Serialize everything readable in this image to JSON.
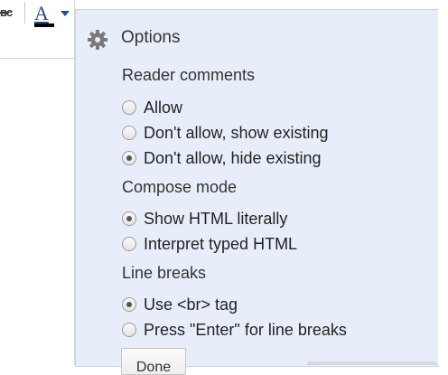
{
  "toolbar": {
    "strikethrough_glyph": "ᴃᴄ",
    "font_color_glyph": "A"
  },
  "options": {
    "title": "Options",
    "icon": "gear-icon",
    "sections": [
      {
        "label": "Reader comments",
        "choices": [
          {
            "label": "Allow",
            "selected": false
          },
          {
            "label": "Don't allow, show existing",
            "selected": false
          },
          {
            "label": "Don't allow, hide existing",
            "selected": true
          }
        ]
      },
      {
        "label": "Compose mode",
        "choices": [
          {
            "label": "Show HTML literally",
            "selected": true
          },
          {
            "label": "Interpret typed HTML",
            "selected": false
          }
        ]
      },
      {
        "label": "Line breaks",
        "choices": [
          {
            "label": "Use <br> tag",
            "selected": true
          },
          {
            "label": "Press \"Enter\" for line breaks",
            "selected": false
          }
        ]
      }
    ],
    "done_label": "Done"
  },
  "colors": {
    "panel_background": "#e8eef9",
    "font_color_accent": "#2a4a8f"
  }
}
